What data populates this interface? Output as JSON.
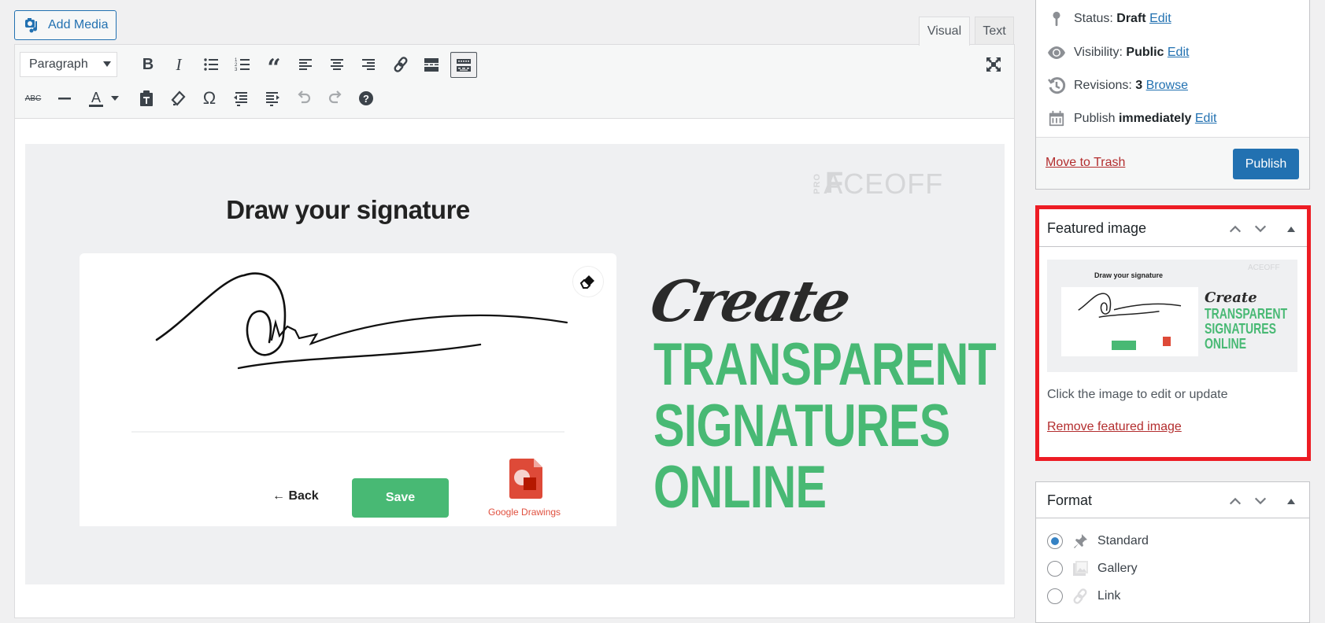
{
  "editor": {
    "add_media_label": "Add Media",
    "tabs": [
      {
        "label": "Visual",
        "active": true
      },
      {
        "label": "Text",
        "active": false
      }
    ],
    "format_select": {
      "value": "Paragraph"
    },
    "toolbar_row1": [
      {
        "name": "bold-icon",
        "label": "B"
      },
      {
        "name": "italic-icon",
        "label": "I"
      },
      {
        "name": "bulleted-list-icon"
      },
      {
        "name": "numbered-list-icon"
      },
      {
        "name": "blockquote-icon"
      },
      {
        "name": "align-left-icon"
      },
      {
        "name": "align-center-icon"
      },
      {
        "name": "align-right-icon"
      },
      {
        "name": "link-icon"
      },
      {
        "name": "read-more-icon"
      },
      {
        "name": "toolbar-toggle-icon",
        "active": true
      }
    ],
    "toolbar_row2": [
      {
        "name": "strikethrough-icon",
        "label": "ABC"
      },
      {
        "name": "horizontal-line-icon"
      },
      {
        "name": "text-color-icon",
        "label": "A"
      },
      {
        "name": "paste-as-text-icon"
      },
      {
        "name": "clear-formatting-icon"
      },
      {
        "name": "special-character-icon",
        "label": "Ω"
      },
      {
        "name": "outdent-icon"
      },
      {
        "name": "indent-icon"
      },
      {
        "name": "undo-icon",
        "disabled": true
      },
      {
        "name": "redo-icon",
        "disabled": true
      },
      {
        "name": "help-icon",
        "label": "?"
      }
    ],
    "fullscreen_icon": "fullscreen-icon"
  },
  "post_image": {
    "brand_prefix": "PRO",
    "brand": "ACEOFF",
    "card_title": "Draw your signature",
    "back_label": "← Back",
    "save_label": "Save",
    "google_drawings_label": "Google Drawings",
    "headline_script": "Create",
    "headline_lines": [
      "TRANSPARENT",
      "SIGNATURES",
      "ONLINE"
    ],
    "accent_color": "#48b974"
  },
  "publish_box": {
    "status_label": "Status:",
    "status_value": "Draft",
    "status_edit": "Edit",
    "visibility_label": "Visibility:",
    "visibility_value": "Public",
    "visibility_edit": "Edit",
    "revisions_label": "Revisions:",
    "revisions_value": "3",
    "revisions_browse": "Browse",
    "publish_label": "Publish",
    "publish_value": "immediately",
    "publish_edit": "Edit",
    "trash_label": "Move to Trash",
    "publish_button": "Publish"
  },
  "featured_image": {
    "title": "Featured image",
    "hint": "Click the image to edit or update",
    "remove_label": "Remove featured image",
    "highlight_color": "#ed1c24"
  },
  "format_box": {
    "title": "Format",
    "options": [
      {
        "label": "Standard",
        "checked": true
      },
      {
        "label": "Gallery",
        "checked": false
      },
      {
        "label": "Link",
        "checked": false
      }
    ]
  }
}
